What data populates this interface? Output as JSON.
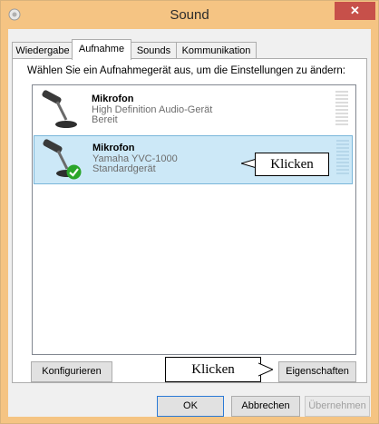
{
  "window": {
    "title": "Sound",
    "close_glyph": "✕",
    "icon": "speaker-icon"
  },
  "tabs": [
    {
      "label": "Wiedergabe",
      "active": false
    },
    {
      "label": "Aufnahme",
      "active": true
    },
    {
      "label": "Sounds",
      "active": false
    },
    {
      "label": "Kommunikation",
      "active": false
    }
  ],
  "instruction": "Wählen Sie ein Aufnahmegerät aus, um die Einstellungen zu ändern:",
  "devices": [
    {
      "name": "Mikrofon",
      "description": "High Definition Audio-Gerät",
      "status": "Bereit",
      "selected": false,
      "default": false
    },
    {
      "name": "Mikrofon",
      "description": "Yamaha YVC-1000",
      "status": "Standardgerät",
      "selected": true,
      "default": true
    }
  ],
  "callouts": {
    "device_callout": "Klicken",
    "properties_callout": "Klicken"
  },
  "buttons": {
    "configure": "Konfigurieren",
    "properties": "Eigenschaften",
    "ok": "OK",
    "cancel": "Abbrechen",
    "apply": "Übernehmen"
  },
  "colors": {
    "title_bar": "#f5c483",
    "close_button": "#c7504a",
    "selection": "#cce8f7",
    "check_badge": "#2aa52a"
  }
}
